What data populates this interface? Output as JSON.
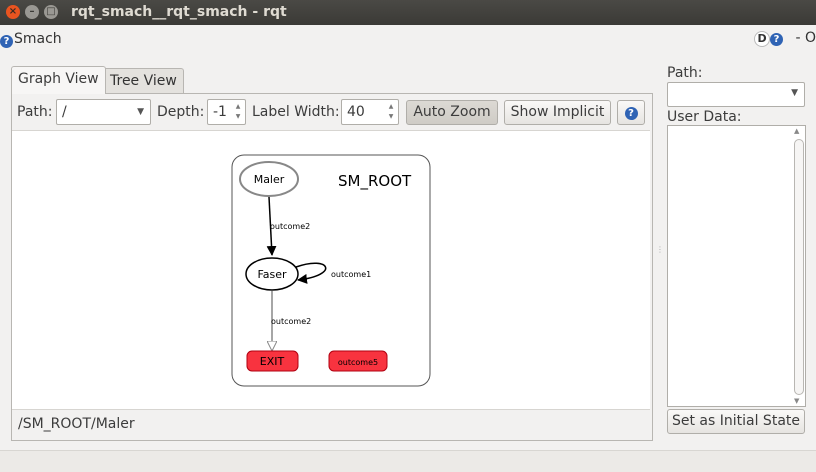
{
  "window": {
    "title": "rqt_smach__rqt_smach - rqt"
  },
  "plugin": {
    "name": "Smach",
    "help_glyph": "?",
    "dock_d": "D",
    "dock_help": "?",
    "dock_rest": "-  O"
  },
  "tabs": [
    {
      "label": "Graph View"
    },
    {
      "label": "Tree View"
    }
  ],
  "toolbar": {
    "path_label": "Path:",
    "path_value": "/",
    "depth_label": "Depth:",
    "depth_value": "-1",
    "label_width_label": "Label Width:",
    "label_width_value": "40",
    "auto_zoom": "Auto Zoom",
    "show_implicit": "Show Implicit",
    "help_glyph": "?"
  },
  "graph": {
    "container_label": "SM_ROOT",
    "nodes": {
      "maler": "Maler",
      "faser": "Faser",
      "exit": "EXIT",
      "outcome5": "outcome5"
    },
    "edges": {
      "maler_faser": "outcome2",
      "faser_self": "outcome1",
      "faser_exit": "outcome2"
    },
    "colors": {
      "outcome_fill": "#f8333f",
      "outcome_stroke": "#b00010",
      "inactive_stroke": "#888888"
    }
  },
  "status": {
    "path": "/SM_ROOT/Maler"
  },
  "right": {
    "path_label": "Path:",
    "path_value": "",
    "user_data_label": "User Data:",
    "set_initial": "Set as Initial State"
  }
}
